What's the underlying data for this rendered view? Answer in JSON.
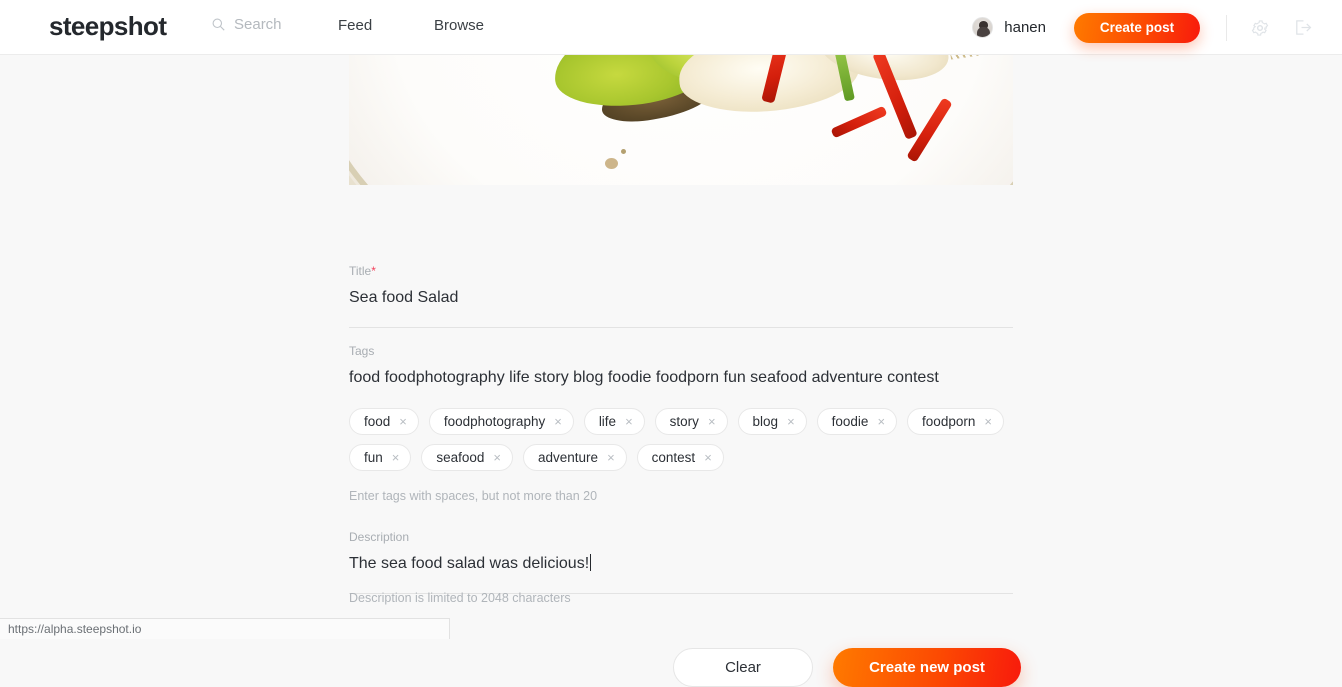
{
  "header": {
    "brand": "steepshot",
    "search": {
      "placeholder": "Search",
      "icon": "search-icon"
    },
    "nav": [
      {
        "label": "Feed"
      },
      {
        "label": "Browse"
      }
    ],
    "user": {
      "name": "hanen",
      "avatar_alt": "user-avatar"
    },
    "create_post_label": "Create post",
    "settings_icon": "gear-icon",
    "logout_icon": "logout-icon"
  },
  "main": {
    "image_alt": "seafood-salad-photo",
    "title": {
      "label": "Title",
      "required_marker": "*",
      "value": "Sea food Salad"
    },
    "tags": {
      "label": "Tags",
      "value": "food foodphotography life story blog foodie foodporn fun seafood adventure contest",
      "hint": "Enter tags with spaces, but not more than 20",
      "chips": [
        {
          "label": "food",
          "remove": "×"
        },
        {
          "label": "foodphotography",
          "remove": "×"
        },
        {
          "label": "life",
          "remove": "×"
        },
        {
          "label": "story",
          "remove": "×"
        },
        {
          "label": "blog",
          "remove": "×"
        },
        {
          "label": "foodie",
          "remove": "×"
        },
        {
          "label": "foodporn",
          "remove": "×"
        },
        {
          "label": "fun",
          "remove": "×"
        },
        {
          "label": "seafood",
          "remove": "×"
        },
        {
          "label": "adventure",
          "remove": "×"
        },
        {
          "label": "contest",
          "remove": "×"
        }
      ]
    },
    "description": {
      "label": "Description",
      "value": "The sea food salad was delicious!",
      "hint": "Description is limited to 2048 characters"
    },
    "actions": {
      "clear_label": "Clear",
      "create_label": "Create new post"
    }
  },
  "status_bar": {
    "url": "https://alpha.steepshot.io"
  },
  "colors": {
    "accent_start": "#ff7a00",
    "accent_end": "#f81a0c",
    "required": "#f2425c",
    "text": "#2c3036",
    "muted": "#a8adb2",
    "background": "#f8f8f8"
  }
}
